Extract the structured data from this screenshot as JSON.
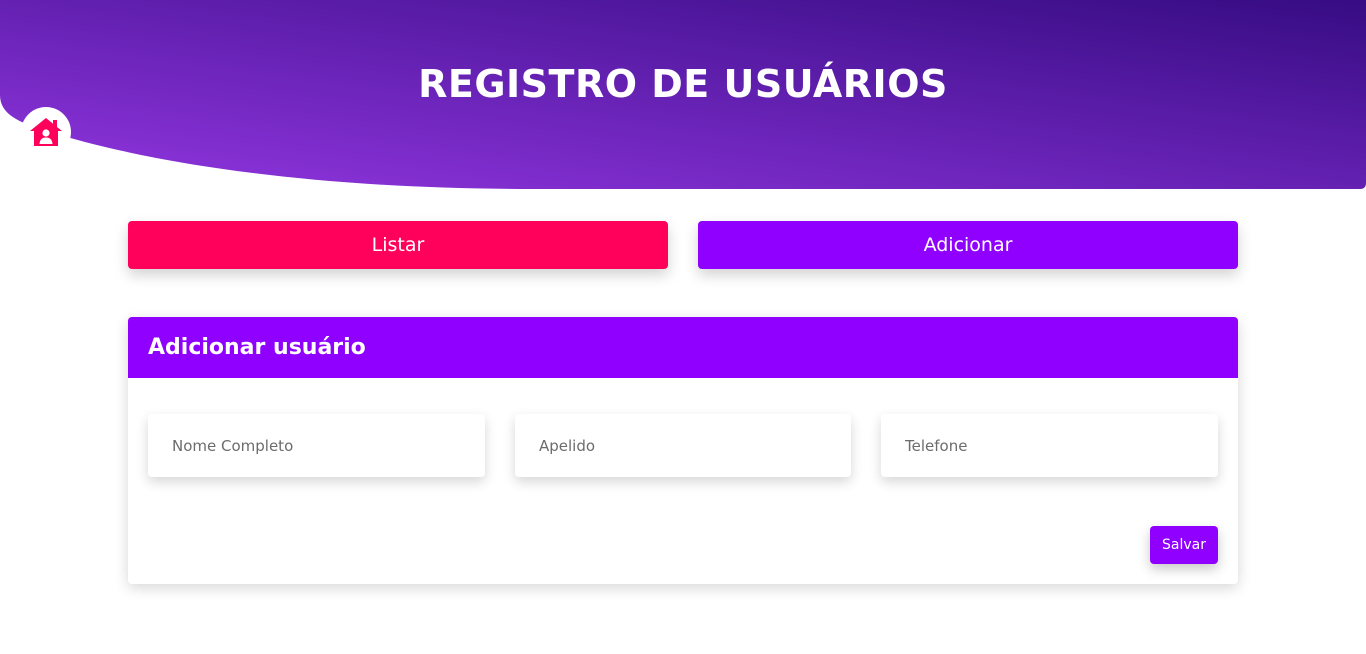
{
  "header": {
    "title": "REGISTRO DE USUÁRIOS",
    "home_icon": "home-user-icon",
    "gradient_start": "#9236e0",
    "gradient_end": "#360c83"
  },
  "actions": {
    "list_label": "Listar",
    "add_label": "Adicionar",
    "list_color": "#ff005a",
    "add_color": "#9000ff"
  },
  "form": {
    "title": "Adicionar usuário",
    "accent": "#9000ff",
    "fields": [
      {
        "placeholder": "Nome Completo",
        "value": ""
      },
      {
        "placeholder": "Apelido",
        "value": ""
      },
      {
        "placeholder": "Telefone",
        "value": ""
      }
    ],
    "save_label": "Salvar"
  }
}
